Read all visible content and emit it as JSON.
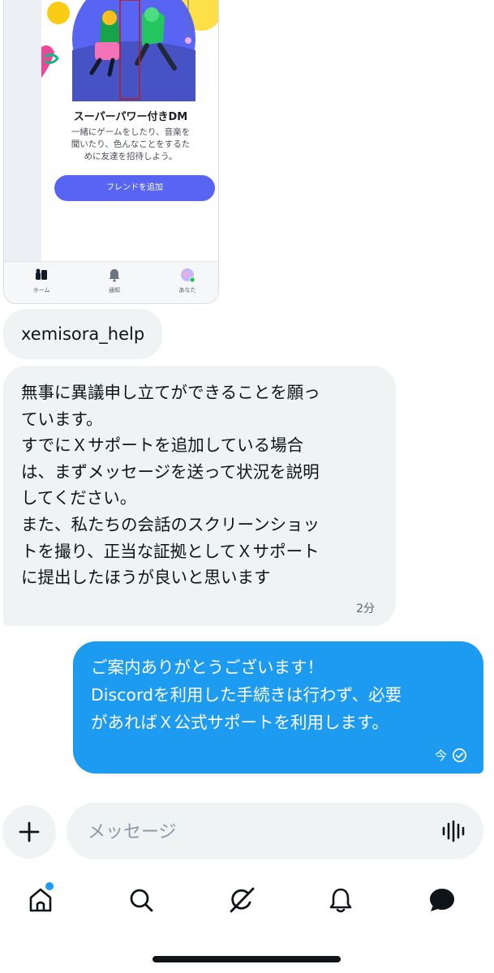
{
  "embedded_screenshot": {
    "title": "スーパーパワー付きDM",
    "description_lines": [
      "一緒にゲームをしたり、音楽を",
      "聞いたり、色んなことをするた",
      "めに友達を招待しよう。"
    ],
    "button_label": "フレンドを追加",
    "nav": [
      {
        "label": "ホーム",
        "icon": "home-icon"
      },
      {
        "label": "通知",
        "icon": "bell-icon"
      },
      {
        "label": "あなた",
        "icon": "avatar-icon"
      }
    ]
  },
  "sender": "xemisora_help",
  "incoming_message": {
    "lines": [
      "無事に異議申し立てができることを願っ",
      "ています。",
      "すでにＸサポートを追加している場合",
      "は、まずメッセージを送って状況を説明",
      "してください。",
      "また、私たちの会話のスクリーンショッ",
      "トを撮り、正当な証拠としてＸサポート",
      "に提出したほうが良いと思います"
    ],
    "time": "2分"
  },
  "outgoing_message": {
    "lines": [
      "ご案内ありがとうございます！",
      "Discordを利用した手続きは行わず、必要",
      "があればＸ公式サポートを利用します。"
    ],
    "time": "今",
    "status_icon": "sent-check-icon"
  },
  "composer": {
    "placeholder": "メッセージ",
    "add_icon": "plus-icon",
    "voice_icon": "voice-waveform-icon"
  },
  "tabbar": [
    {
      "icon": "home-icon",
      "has_notification_dot": true
    },
    {
      "icon": "search-icon"
    },
    {
      "icon": "grok-icon"
    },
    {
      "icon": "bell-icon"
    },
    {
      "icon": "messages-icon",
      "active": true
    }
  ],
  "colors": {
    "accent": "#1d9bf0",
    "incoming_bubble": "#eff3f4",
    "discord_blurple": "#5865f2"
  }
}
